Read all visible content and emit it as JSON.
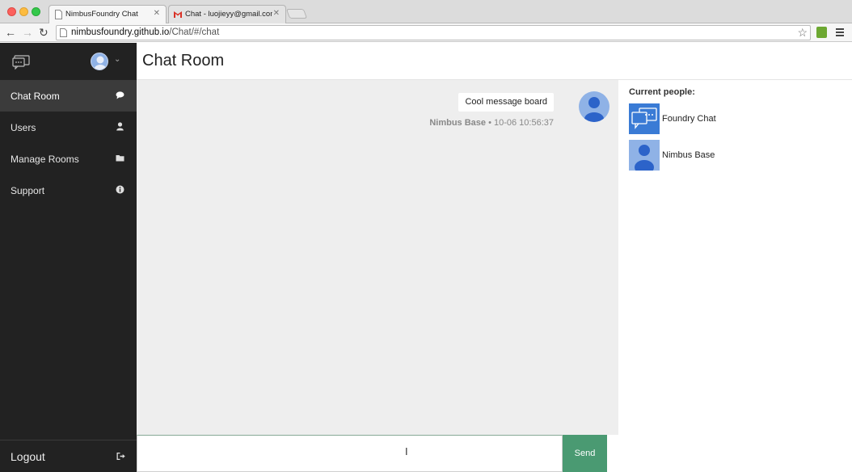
{
  "browser": {
    "tabs": [
      {
        "title": "NimbusFoundry Chat",
        "active": true
      },
      {
        "title": "Chat - luojieyy@gmail.com",
        "active": false
      }
    ],
    "url_host": "nimbusfoundry.github.io",
    "url_path": "/Chat/#/chat"
  },
  "sidebar": {
    "items": [
      {
        "label": "Chat Room",
        "icon": "comment-icon",
        "active": true
      },
      {
        "label": "Users",
        "icon": "user-icon",
        "active": false
      },
      {
        "label": "Manage Rooms",
        "icon": "folder-icon",
        "active": false
      },
      {
        "label": "Support",
        "icon": "info-icon",
        "active": false
      }
    ],
    "logout_label": "Logout"
  },
  "header": {
    "title": "Chat Room"
  },
  "messages": [
    {
      "text": "Cool message board",
      "author": "Nimbus Base",
      "time": "10-06 10:56:37"
    }
  ],
  "people": {
    "title": "Current people:",
    "list": [
      {
        "name": "Foundry Chat",
        "avatar": "chat-bubble-avatar"
      },
      {
        "name": "Nimbus Base",
        "avatar": "person-avatar"
      }
    ]
  },
  "composer": {
    "send_label": "Send",
    "value": ""
  },
  "colors": {
    "sidebar": "#222222",
    "send": "#4a9a72",
    "accent_blue": "#3a7bd5"
  }
}
